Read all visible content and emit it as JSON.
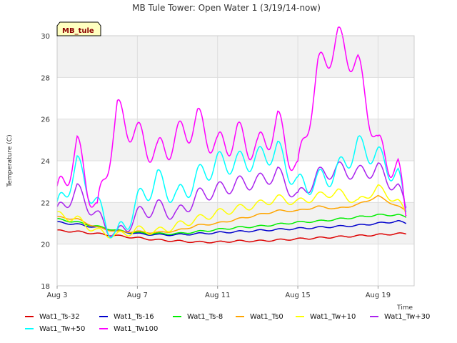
{
  "chart_data": {
    "type": "line",
    "title": "MB Tule Tower: Open Water 1 (3/19/14-now)",
    "xlabel": "Time",
    "ylabel": "Temperature (C)",
    "ylim": [
      18,
      30
    ],
    "xlim": [
      0,
      17.8
    ],
    "yticks": [
      "18",
      "20",
      "22",
      "24",
      "26",
      "28",
      "30"
    ],
    "xticks": [
      {
        "label": "Aug 3",
        "day": 0
      },
      {
        "label": "Aug 7",
        "day": 4
      },
      {
        "label": "Aug 11",
        "day": 8
      },
      {
        "label": "Aug 15",
        "day": 12
      },
      {
        "label": "Aug 19",
        "day": 16
      }
    ],
    "station_tag": "MB_tule",
    "grid": true,
    "legend_position": "bottom",
    "series": [
      {
        "name": "Wat1_Ts-32",
        "color": "#dd0000",
        "x": [
          0,
          1,
          2,
          3,
          4,
          5,
          6,
          7,
          8,
          9,
          10,
          11,
          12,
          13,
          14,
          15,
          16,
          17,
          17.4
        ],
        "y": [
          20.65,
          20.6,
          20.5,
          20.4,
          20.3,
          20.2,
          20.15,
          20.1,
          20.1,
          20.15,
          20.15,
          20.2,
          20.25,
          20.3,
          20.35,
          20.4,
          20.45,
          20.5,
          20.5
        ]
      },
      {
        "name": "Wat1_Ts-16",
        "color": "#0000cc",
        "x": [
          0,
          1,
          2,
          3,
          4,
          5,
          6,
          7,
          8,
          9,
          10,
          11,
          12,
          13,
          14,
          15,
          16,
          17,
          17.4
        ],
        "y": [
          21.05,
          20.95,
          20.8,
          20.65,
          20.5,
          20.45,
          20.45,
          20.5,
          20.55,
          20.6,
          20.65,
          20.7,
          20.75,
          20.8,
          20.85,
          20.9,
          21.0,
          21.1,
          21.0
        ]
      },
      {
        "name": "Wat1_Ts-8",
        "color": "#00ee00",
        "x": [
          0,
          1,
          2,
          3,
          4,
          5,
          6,
          7,
          8,
          9,
          10,
          11,
          12,
          13,
          14,
          15,
          16,
          17,
          17.4
        ],
        "y": [
          21.2,
          21.05,
          20.85,
          20.65,
          20.55,
          20.5,
          20.5,
          20.6,
          20.7,
          20.8,
          20.85,
          20.95,
          21.05,
          21.1,
          21.2,
          21.3,
          21.4,
          21.4,
          21.3
        ]
      },
      {
        "name": "Wat1_Ts0",
        "color": "#ffa500",
        "x": [
          0,
          1,
          2,
          3,
          4,
          5,
          6,
          7,
          8,
          9,
          10,
          11,
          12,
          13,
          14,
          15,
          16,
          17,
          17.4
        ],
        "y": [
          21.3,
          21.2,
          20.8,
          20.6,
          20.6,
          20.55,
          20.65,
          20.9,
          21.0,
          21.2,
          21.4,
          21.6,
          21.6,
          21.8,
          21.7,
          21.9,
          22.3,
          21.8,
          21.6
        ]
      },
      {
        "name": "Wat1_Tw+10",
        "color": "#ffff00",
        "x": [
          0,
          1,
          2,
          3,
          4,
          5,
          6,
          7,
          8,
          9,
          10,
          11,
          12,
          13,
          14,
          15,
          16,
          17,
          17.4
        ],
        "y": [
          21.4,
          21.2,
          20.6,
          20.4,
          20.7,
          20.6,
          20.9,
          21.2,
          21.5,
          21.7,
          21.9,
          22.2,
          22.0,
          22.3,
          22.5,
          22.0,
          22.7,
          22.0,
          21.5
        ]
      },
      {
        "name": "Wat1_Tw+30",
        "color": "#aa22ee",
        "x": [
          0,
          1,
          2,
          3,
          4,
          5,
          6,
          7,
          8,
          9,
          10,
          11,
          12,
          13,
          14,
          15,
          16,
          17,
          17.4
        ],
        "y": [
          21.5,
          22.6,
          21.3,
          20.4,
          21.4,
          21.8,
          21.4,
          22.3,
          22.6,
          22.9,
          23.0,
          23.4,
          22.2,
          23.3,
          23.6,
          23.4,
          23.6,
          22.6,
          21.8
        ]
      },
      {
        "name": "Wat1_Tw+50",
        "color": "#00ffff",
        "x": [
          0,
          1,
          2,
          3,
          4,
          5,
          6,
          7,
          8,
          9,
          10,
          11,
          12,
          13,
          14,
          15,
          16,
          17,
          17.4
        ],
        "y": [
          21.6,
          23.8,
          21.8,
          20.3,
          22.0,
          23.1,
          22.2,
          23.2,
          23.9,
          23.9,
          24.1,
          24.5,
          22.8,
          23.0,
          23.5,
          24.7,
          24.2,
          23.2,
          21.6
        ]
      },
      {
        "name": "Wat1_Tw100",
        "color": "#ff00ff",
        "x": [
          0,
          1,
          2,
          3,
          4,
          5,
          6,
          7,
          8,
          9,
          10,
          11,
          12,
          13,
          14,
          15,
          16,
          17,
          17.4
        ],
        "y": [
          22.2,
          24.6,
          21.4,
          26.3,
          25.2,
          24.3,
          25.1,
          25.9,
          24.6,
          25.2,
          24.5,
          25.8,
          23.4,
          28.3,
          29.8,
          28.5,
          24.6,
          23.5,
          21.4
        ]
      }
    ]
  }
}
